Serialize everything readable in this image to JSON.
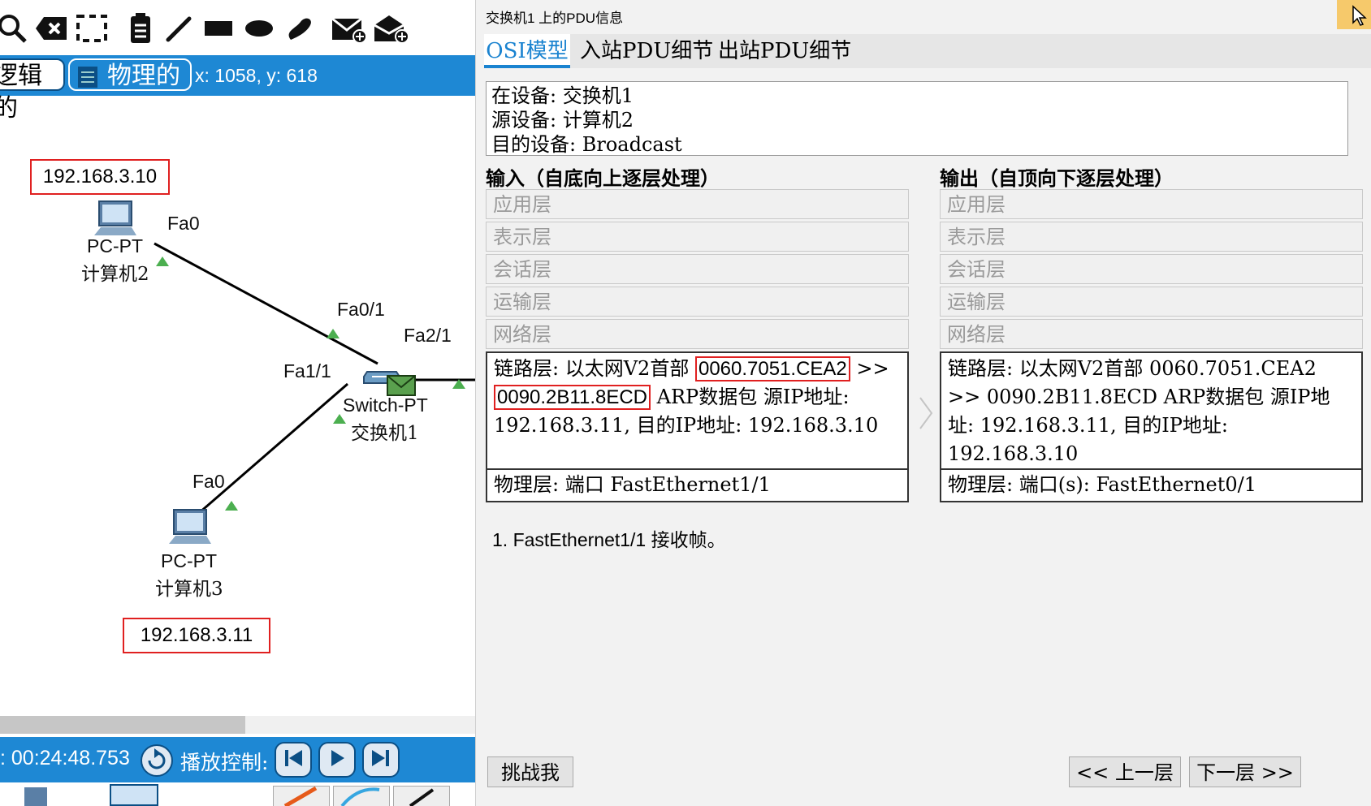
{
  "workspace": {
    "mode_logical": "逻辑的",
    "mode_physical": "物理的",
    "coords": "x: 1058, y: 618",
    "devices": [
      {
        "model": "PC-PT",
        "name": "计算机2",
        "port": "Fa0",
        "ip": "192.168.3.10"
      },
      {
        "model": "Switch-PT",
        "name": "交换机1",
        "ports": [
          "Fa0/1",
          "Fa2/1",
          "Fa1/1"
        ]
      },
      {
        "model": "PC-PT",
        "name": "计算机3",
        "port": "Fa0",
        "ip": "192.168.3.11"
      }
    ],
    "timer": ": 00:24:48.753",
    "playback_label": "播放控制:"
  },
  "panel": {
    "title": "交换机1 上的PDU信息",
    "tabs": [
      "OSI模型",
      "入站PDU细节",
      "出站PDU细节"
    ],
    "info": {
      "at_device": "在设备: 交换机1",
      "source": "源设备: 计算机2",
      "destination": "目的设备: Broadcast"
    },
    "in_header": "输入（自底向上逐层处理）",
    "out_header": "输出（自顶向下逐层处理）",
    "layers_gray": [
      "应用层",
      "表示层",
      "会话层",
      "运输层",
      "网络层"
    ],
    "in_datalink": {
      "prefix": "链路层: 以太网V2首部",
      "mac1": "0060.7051.CEA2",
      "arrow": ">>",
      "mac2": "0090.2B11.8ECD",
      "rest": "ARP数据包 源IP地址: 192.168.3.11, 目的IP地址: 192.168.3.10"
    },
    "in_physical": "物理层: 端口 FastEthernet1/1",
    "out_datalink": "链路层: 以太网V2首部 0060.7051.CEA2 >> 0090.2B11.8ECD ARP数据包 源IP地址: 192.168.3.11, 目的IP地址: 192.168.3.10",
    "out_physical": "物理层: 端口(s): FastEthernet0/1",
    "explanation": "1. FastEthernet1/1 接收帧。",
    "challenge_button": "挑战我",
    "prev_button": "<< 上一层",
    "next_button": "下一层 >>"
  },
  "colors": {
    "accent": "#1e88d4",
    "highlight": "#e02020",
    "link": "#000000",
    "port_marker": "#4caf50"
  }
}
